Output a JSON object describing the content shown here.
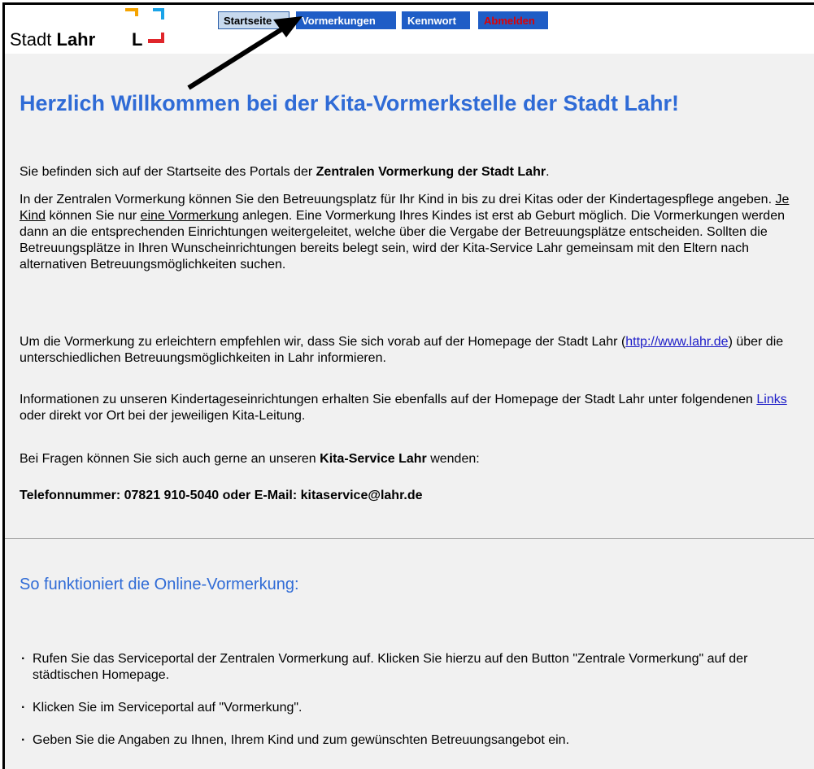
{
  "header": {
    "logo": {
      "brand_prefix": "Stadt",
      "brand_name": "Lahr",
      "brand_initial": "L"
    },
    "nav": [
      {
        "id": "startseite",
        "label": "Startseite"
      },
      {
        "id": "vormerkungen",
        "label": "Vormerkungen"
      },
      {
        "id": "kennwort",
        "label": "Kennwort"
      },
      {
        "id": "abmelden",
        "label": "Abmelden"
      }
    ]
  },
  "main": {
    "title": "Herzlich Willkommen bei der Kita-Vormerkstelle der Stadt Lahr!",
    "intro": {
      "text_before": "Sie befinden sich auf der Startseite des Portals der ",
      "bold": "Zentralen Vormerkung der Stadt Lahr",
      "text_after": "."
    },
    "para2": {
      "t1": "In der Zentralen Vormerkung können Sie den Betreuungsplatz für Ihr Kind in bis zu drei Kitas oder der Kindertagespflege angeben. ",
      "u1": "Je Kind",
      "t2": " können Sie nur ",
      "u2": "eine Vormerkung",
      "t3": " anlegen. Eine Vormerkung Ihres Kindes ist erst ab Geburt möglich. Die Vormerkungen werden dann an die entsprechenden Einrichtungen weitergeleitet, welche über die Vergabe der Betreuungsplätze entscheiden. Sollten die Betreuungsplätze in Ihren Wunscheinrichtungen bereits belegt sein, wird der Kita-Service Lahr gemeinsam mit den Eltern nach alternativen Betreuungsmöglichkeiten suchen."
    },
    "para3": {
      "t1": "Um die Vormerkung zu erleichtern empfehlen wir, dass Sie sich vorab auf der Homepage der Stadt Lahr (",
      "link": "http://www.lahr.de",
      "t2": ") über die unterschiedlichen Betreuungsmöglichkeiten in Lahr informieren."
    },
    "para4": {
      "t1": "Informationen zu unseren Kindertageseinrichtungen erhalten Sie ebenfalls auf der Homepage der Stadt Lahr unter folgendenen ",
      "link": "Links",
      "t2": " oder direkt vor Ort bei der jeweiligen Kita-Leitung."
    },
    "para5": {
      "t1": "Bei Fragen können Sie sich auch gerne an unseren ",
      "bold": "Kita-Service Lahr",
      "t2": " wenden:"
    },
    "contact": "Telefonnummer: 07821 910-5040 oder E-Mail: kitaservice@lahr.de",
    "section_title": "So funktioniert die Online-Vormerkung:",
    "steps": [
      "Rufen Sie das Serviceportal der Zentralen Vormerkung auf. Klicken Sie hierzu auf den Button \"Zentrale Vormerkung\" auf der städtischen Homepage.",
      "Klicken Sie im Serviceportal auf \"Vormerkung\".",
      "Geben Sie die Angaben zu Ihnen, Ihrem Kind und zum gewünschten Betreuungsangebot ein."
    ]
  },
  "colors": {
    "accent_blue": "#2f6bd6",
    "nav_blue": "#1f5dc6",
    "logout_red": "#e00000",
    "content_bg": "#f1f1f1",
    "logo_orange": "#f5a300",
    "logo_cyan": "#1aa3e8",
    "logo_red": "#e0262b"
  },
  "icons": [
    "logo-mark-icon",
    "annotation-arrow-icon"
  ]
}
